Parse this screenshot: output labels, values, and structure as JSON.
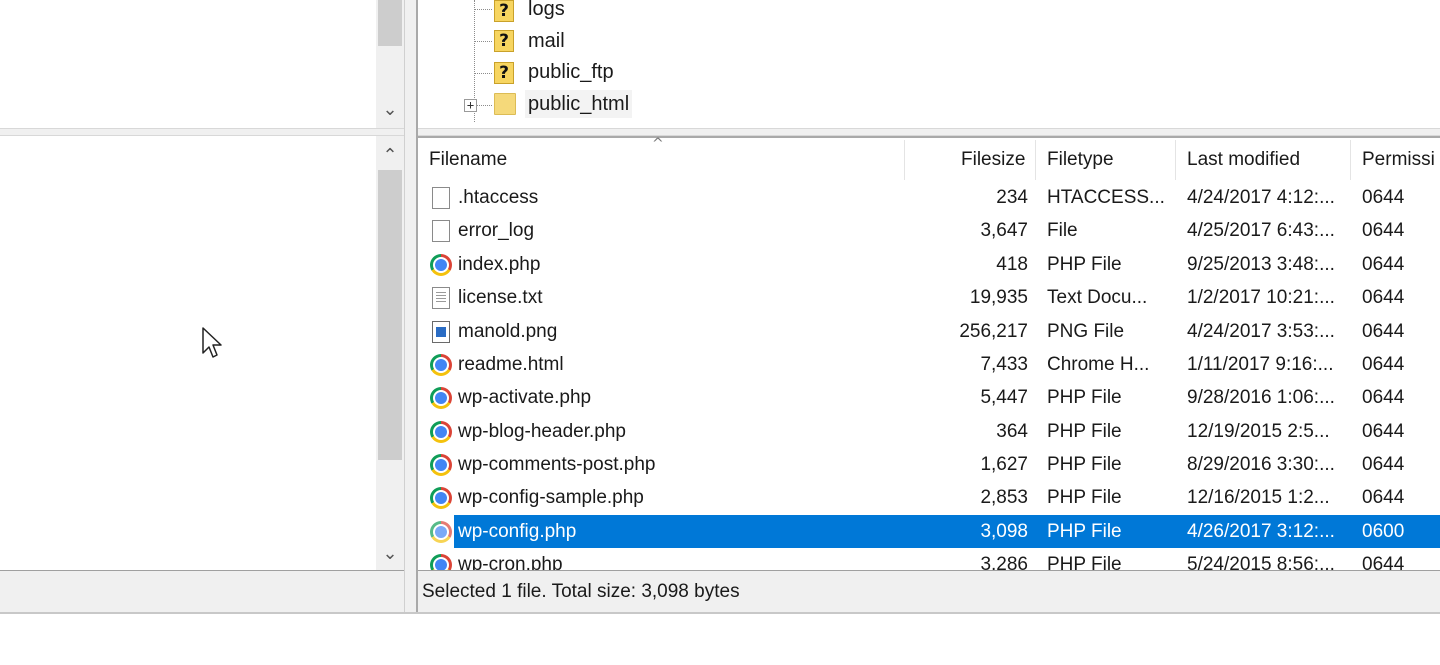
{
  "remote_tree": {
    "items": [
      {
        "label": "logs",
        "icon": "unknown-folder-icon"
      },
      {
        "label": "mail",
        "icon": "unknown-folder-icon"
      },
      {
        "label": "public_ftp",
        "icon": "unknown-folder-icon"
      },
      {
        "label": "public_html",
        "icon": "folder-icon",
        "expandable": true
      }
    ],
    "unknown_glyph": "?",
    "expand_glyph": "+"
  },
  "scroll": {
    "up_glyph": "⌃",
    "down_glyph": "⌄"
  },
  "file_list": {
    "columns": {
      "filename": "Filename",
      "filesize": "Filesize",
      "filetype": "Filetype",
      "last_modified": "Last modified",
      "permissions": "Permissi"
    },
    "sort_glyph": "^",
    "rows": [
      {
        "name": ".htaccess",
        "size": "234",
        "type": "HTACCESS...",
        "modified": "4/24/2017 4:12:...",
        "perm": "0644",
        "icon": "blank-file-icon"
      },
      {
        "name": "error_log",
        "size": "3,647",
        "type": "File",
        "modified": "4/25/2017 6:43:...",
        "perm": "0644",
        "icon": "blank-file-icon"
      },
      {
        "name": "index.php",
        "size": "418",
        "type": "PHP File",
        "modified": "9/25/2013 3:48:...",
        "perm": "0644",
        "icon": "chrome-icon"
      },
      {
        "name": "license.txt",
        "size": "19,935",
        "type": "Text Docu...",
        "modified": "1/2/2017 10:21:...",
        "perm": "0644",
        "icon": "text-file-icon"
      },
      {
        "name": "manold.png",
        "size": "256,217",
        "type": "PNG File",
        "modified": "4/24/2017 3:53:...",
        "perm": "0644",
        "icon": "image-file-icon"
      },
      {
        "name": "readme.html",
        "size": "7,433",
        "type": "Chrome H...",
        "modified": "1/11/2017 9:16:...",
        "perm": "0644",
        "icon": "chrome-icon"
      },
      {
        "name": "wp-activate.php",
        "size": "5,447",
        "type": "PHP File",
        "modified": "9/28/2016 1:06:...",
        "perm": "0644",
        "icon": "chrome-icon"
      },
      {
        "name": "wp-blog-header.php",
        "size": "364",
        "type": "PHP File",
        "modified": "12/19/2015 2:5...",
        "perm": "0644",
        "icon": "chrome-icon"
      },
      {
        "name": "wp-comments-post.php",
        "size": "1,627",
        "type": "PHP File",
        "modified": "8/29/2016 3:30:...",
        "perm": "0644",
        "icon": "chrome-icon"
      },
      {
        "name": "wp-config-sample.php",
        "size": "2,853",
        "type": "PHP File",
        "modified": "12/16/2015 1:2...",
        "perm": "0644",
        "icon": "chrome-icon"
      },
      {
        "name": "wp-config.php",
        "size": "3,098",
        "type": "PHP File",
        "modified": "4/26/2017 3:12:...",
        "perm": "0600",
        "icon": "chrome-icon",
        "selected": true
      },
      {
        "name": "wp-cron.php",
        "size": "3,286",
        "type": "PHP File",
        "modified": "5/24/2015 8:56:...",
        "perm": "0644",
        "icon": "chrome-icon"
      }
    ]
  },
  "status": {
    "text": "Selected 1 file. Total size: 3,098 bytes"
  },
  "colors": {
    "selection": "#0078d7",
    "pane_bg": "#ffffff",
    "chrome_bg": "#f0f0f0"
  }
}
